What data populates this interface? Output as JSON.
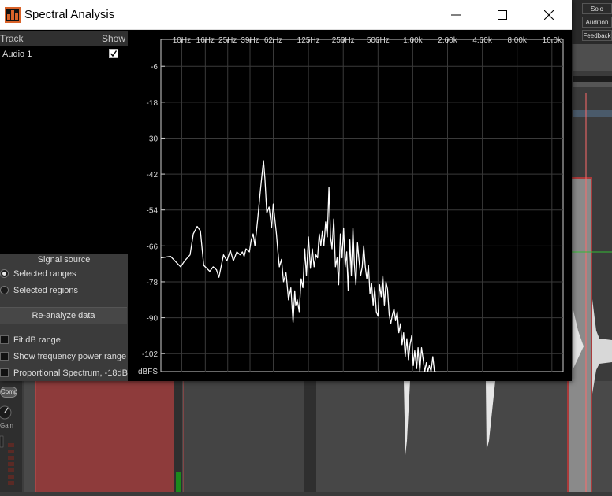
{
  "window": {
    "title": "Spectral Analysis",
    "minimize_label": "Minimize",
    "maximize_label": "Maximize",
    "close_label": "Close"
  },
  "track_list": {
    "header_track": "Track",
    "header_show": "Show",
    "tracks": [
      {
        "name": "Audio 1",
        "show": true
      }
    ]
  },
  "signal_source": {
    "title": "Signal source",
    "options": [
      {
        "label": "Selected ranges",
        "selected": true
      },
      {
        "label": "Selected regions",
        "selected": false
      }
    ]
  },
  "buttons": {
    "reanalyze": "Re-analyze data"
  },
  "options": {
    "fit_db_range": "Fit dB range",
    "show_freq_power_range": "Show frequency power range",
    "proportional_spectrum": "Proportional Spectrum, -18dB"
  },
  "background": {
    "solo": "Solo",
    "audition": "Audition",
    "feedback": "Feedback",
    "comp": "Comp",
    "gain": "Gain"
  },
  "chart_data": {
    "type": "line",
    "ylabel": "dBFS",
    "x_tick_labels": [
      "10Hz",
      "16Hz",
      "25Hz",
      "39Hz",
      "62Hz",
      "125Hz",
      "250Hz",
      "500Hz",
      "1.00k",
      "2.00k",
      "4.00k",
      "8.00k",
      "16.0k"
    ],
    "x_tick_freqs": [
      10,
      16,
      25,
      39,
      62,
      125,
      250,
      500,
      1000,
      2000,
      4000,
      8000,
      16000
    ],
    "xlim": [
      6.6,
      20000
    ],
    "y_ticks": [
      -6,
      -18,
      -30,
      -42,
      -54,
      -66,
      -78,
      -90,
      -102
    ],
    "ylim": [
      -108,
      3
    ],
    "grid": true,
    "series": [
      {
        "color": "#ffffff",
        "x": [
          6.6,
          8.0,
          9.8,
          10.6,
          11.8,
          12.6,
          13.6,
          14.5,
          15.5,
          17.5,
          18.7,
          20.0,
          21.0,
          23.0,
          24.6,
          26.3,
          28.0,
          30.0,
          32.0,
          33.5,
          34.7,
          36.0,
          38.5,
          40.0,
          41.5,
          43.0,
          45.5,
          47.5,
          49.0,
          51.0,
          52.5,
          54.5,
          57.0,
          60.0,
          62.0,
          64.0,
          66.0,
          68.0,
          70.0,
          73.0,
          76.0,
          80.0,
          84.0,
          88.0,
          92.0,
          95.0,
          97.0,
          100.0,
          104.0,
          108.0,
          112.0,
          116.0,
          120.0,
          125.0,
          130.0,
          135.0,
          140.0,
          145.0,
          150.0,
          155.0,
          160.0,
          165.0,
          170.0,
          176.0,
          182.0,
          188.0,
          194.0,
          200.0,
          207.0,
          214.0,
          221.0,
          228.0,
          236.0,
          244.0,
          252.0,
          260.0,
          268.0,
          276.0,
          285.0,
          294.0,
          303.0,
          312.0,
          322.0,
          332.0,
          343.0,
          354.0,
          365.0,
          376.0,
          388.0,
          400.0,
          413.0,
          426.0,
          440.0,
          454.0,
          469.0,
          484.0,
          500.0,
          516.0,
          533.0,
          550.0,
          568.0,
          586.0,
          605.0,
          625.0,
          645.0,
          666.0,
          688.0,
          710.0,
          733.0,
          757.0,
          782.0,
          807.0,
          833.0,
          860.0,
          888.0,
          917.0,
          947.0,
          978.0,
          1010.0,
          1040.0,
          1080.0,
          1110.0,
          1150.0,
          1190.0,
          1230.0,
          1270.0,
          1310.0,
          1350.0,
          1390.0,
          1440.0,
          1490.0,
          1540.0,
          1590.0
        ],
        "y": [
          -70.0,
          -69.5,
          -73.0,
          -71.0,
          -69.0,
          -62.0,
          -59.5,
          -61.0,
          -72.5,
          -74.5,
          -73.0,
          -74.0,
          -76.5,
          -69.0,
          -71.0,
          -67.5,
          -71.0,
          -68.0,
          -69.0,
          -68.0,
          -69.5,
          -67.0,
          -68.0,
          -64.0,
          -62.0,
          -66.0,
          -57.0,
          -49.0,
          -44.0,
          -37.5,
          -43.5,
          -55.0,
          -53.0,
          -60.0,
          -52.0,
          -57.0,
          -62.0,
          -68.0,
          -73.0,
          -70.5,
          -78.0,
          -75.0,
          -84.0,
          -80.0,
          -91.5,
          -81.0,
          -86.0,
          -84.0,
          -88.0,
          -77.0,
          -80.0,
          -67.0,
          -76.0,
          -63.0,
          -73.5,
          -67.0,
          -73.0,
          -69.0,
          -70.0,
          -62.0,
          -66.0,
          -61.0,
          -66.0,
          -58.0,
          -63.0,
          -46.5,
          -63.0,
          -67.0,
          -57.0,
          -73.0,
          -70.0,
          -79.0,
          -62.0,
          -70.0,
          -60.0,
          -73.0,
          -68.0,
          -81.0,
          -64.0,
          -76.0,
          -60.0,
          -72.0,
          -79.0,
          -65.0,
          -71.0,
          -76.0,
          -73.0,
          -66.0,
          -73.0,
          -77.0,
          -72.5,
          -82.0,
          -78.5,
          -86.0,
          -80.0,
          -88.0,
          -89.5,
          -79.0,
          -83.0,
          -76.0,
          -86.0,
          -78.0,
          -80.5,
          -89.0,
          -92.0,
          -89.0,
          -87.0,
          -91.0,
          -88.0,
          -95.0,
          -92.0,
          -99.0,
          -95.0,
          -103.0,
          -97.0,
          -104.0,
          -99.0,
          -96.0,
          -106.0,
          -101.0,
          -107.0,
          -100.0,
          -108.0,
          -100.0,
          -104.0,
          -108.0,
          -105.0,
          -108.0,
          -106.0,
          -108.0,
          -103.0,
          -108.0,
          -108.0
        ]
      }
    ]
  }
}
